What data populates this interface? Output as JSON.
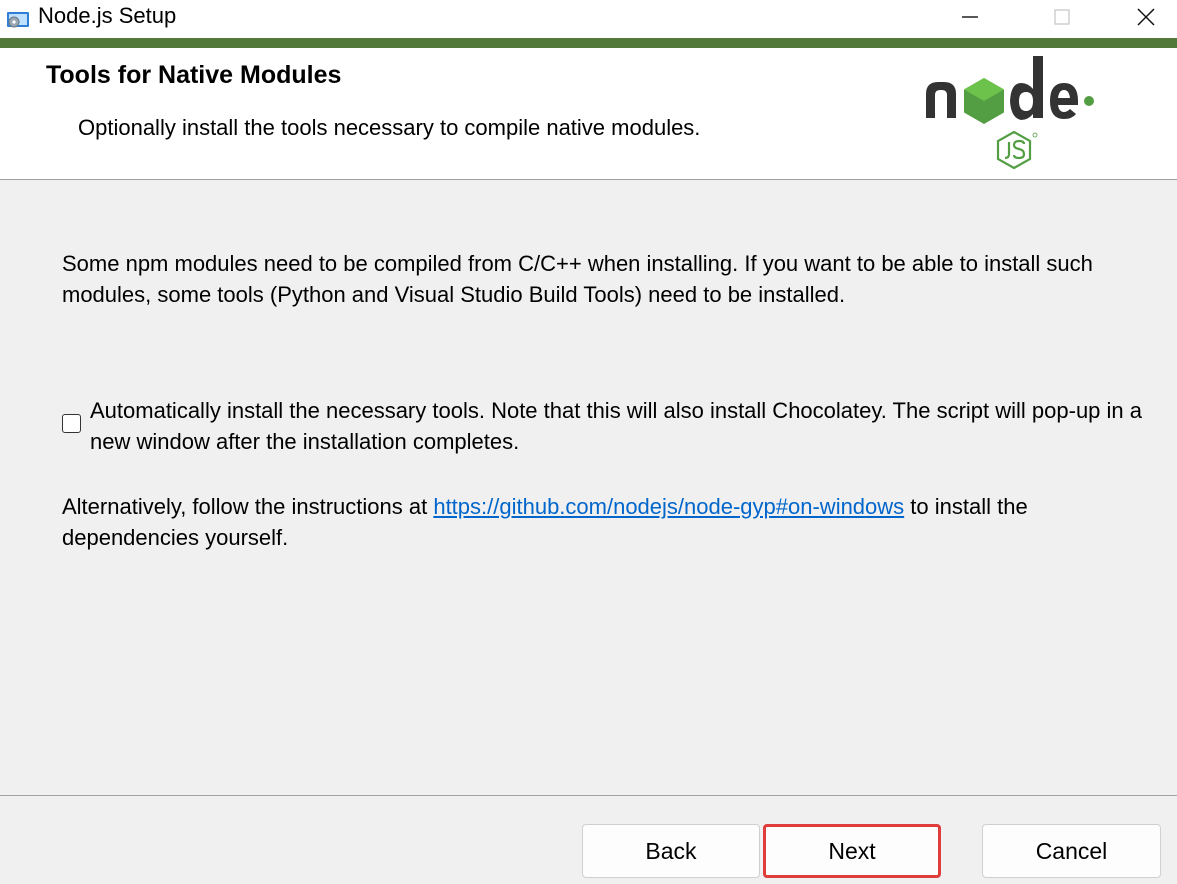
{
  "window": {
    "title": "Node.js Setup",
    "icon": "installer-icon",
    "controls": [
      "minimize-icon",
      "maximize-icon",
      "close-icon"
    ]
  },
  "header": {
    "title": "Tools for Native Modules",
    "subtitle": "Optionally install the tools necessary to compile native modules.",
    "logo": {
      "text": "node",
      "badge": "JS",
      "colors": {
        "dark": "#333333",
        "green": "#539e43"
      }
    }
  },
  "body": {
    "intro": "Some npm modules need to be compiled from C/C++ when installing. If you want to be able to install such modules, some tools (Python and Visual Studio Build Tools) need to be installed.",
    "checkbox": {
      "label": "Automatically install the necessary tools. Note that this will also install Chocolatey. The script will pop-up in a new window after the installation completes.",
      "checked": false
    },
    "alt_prefix": "Alternatively, follow the instructions at ",
    "alt_link": "https://github.com/nodejs/node-gyp#on-windows",
    "alt_suffix": " to install the dependencies yourself."
  },
  "buttons": {
    "back": "Back",
    "next": "Next",
    "cancel": "Cancel",
    "highlighted": "next"
  },
  "colors": {
    "accent": "#52783a",
    "link": "#0066cc",
    "highlight": "#e03c3c",
    "background": "#f0f0f0"
  }
}
